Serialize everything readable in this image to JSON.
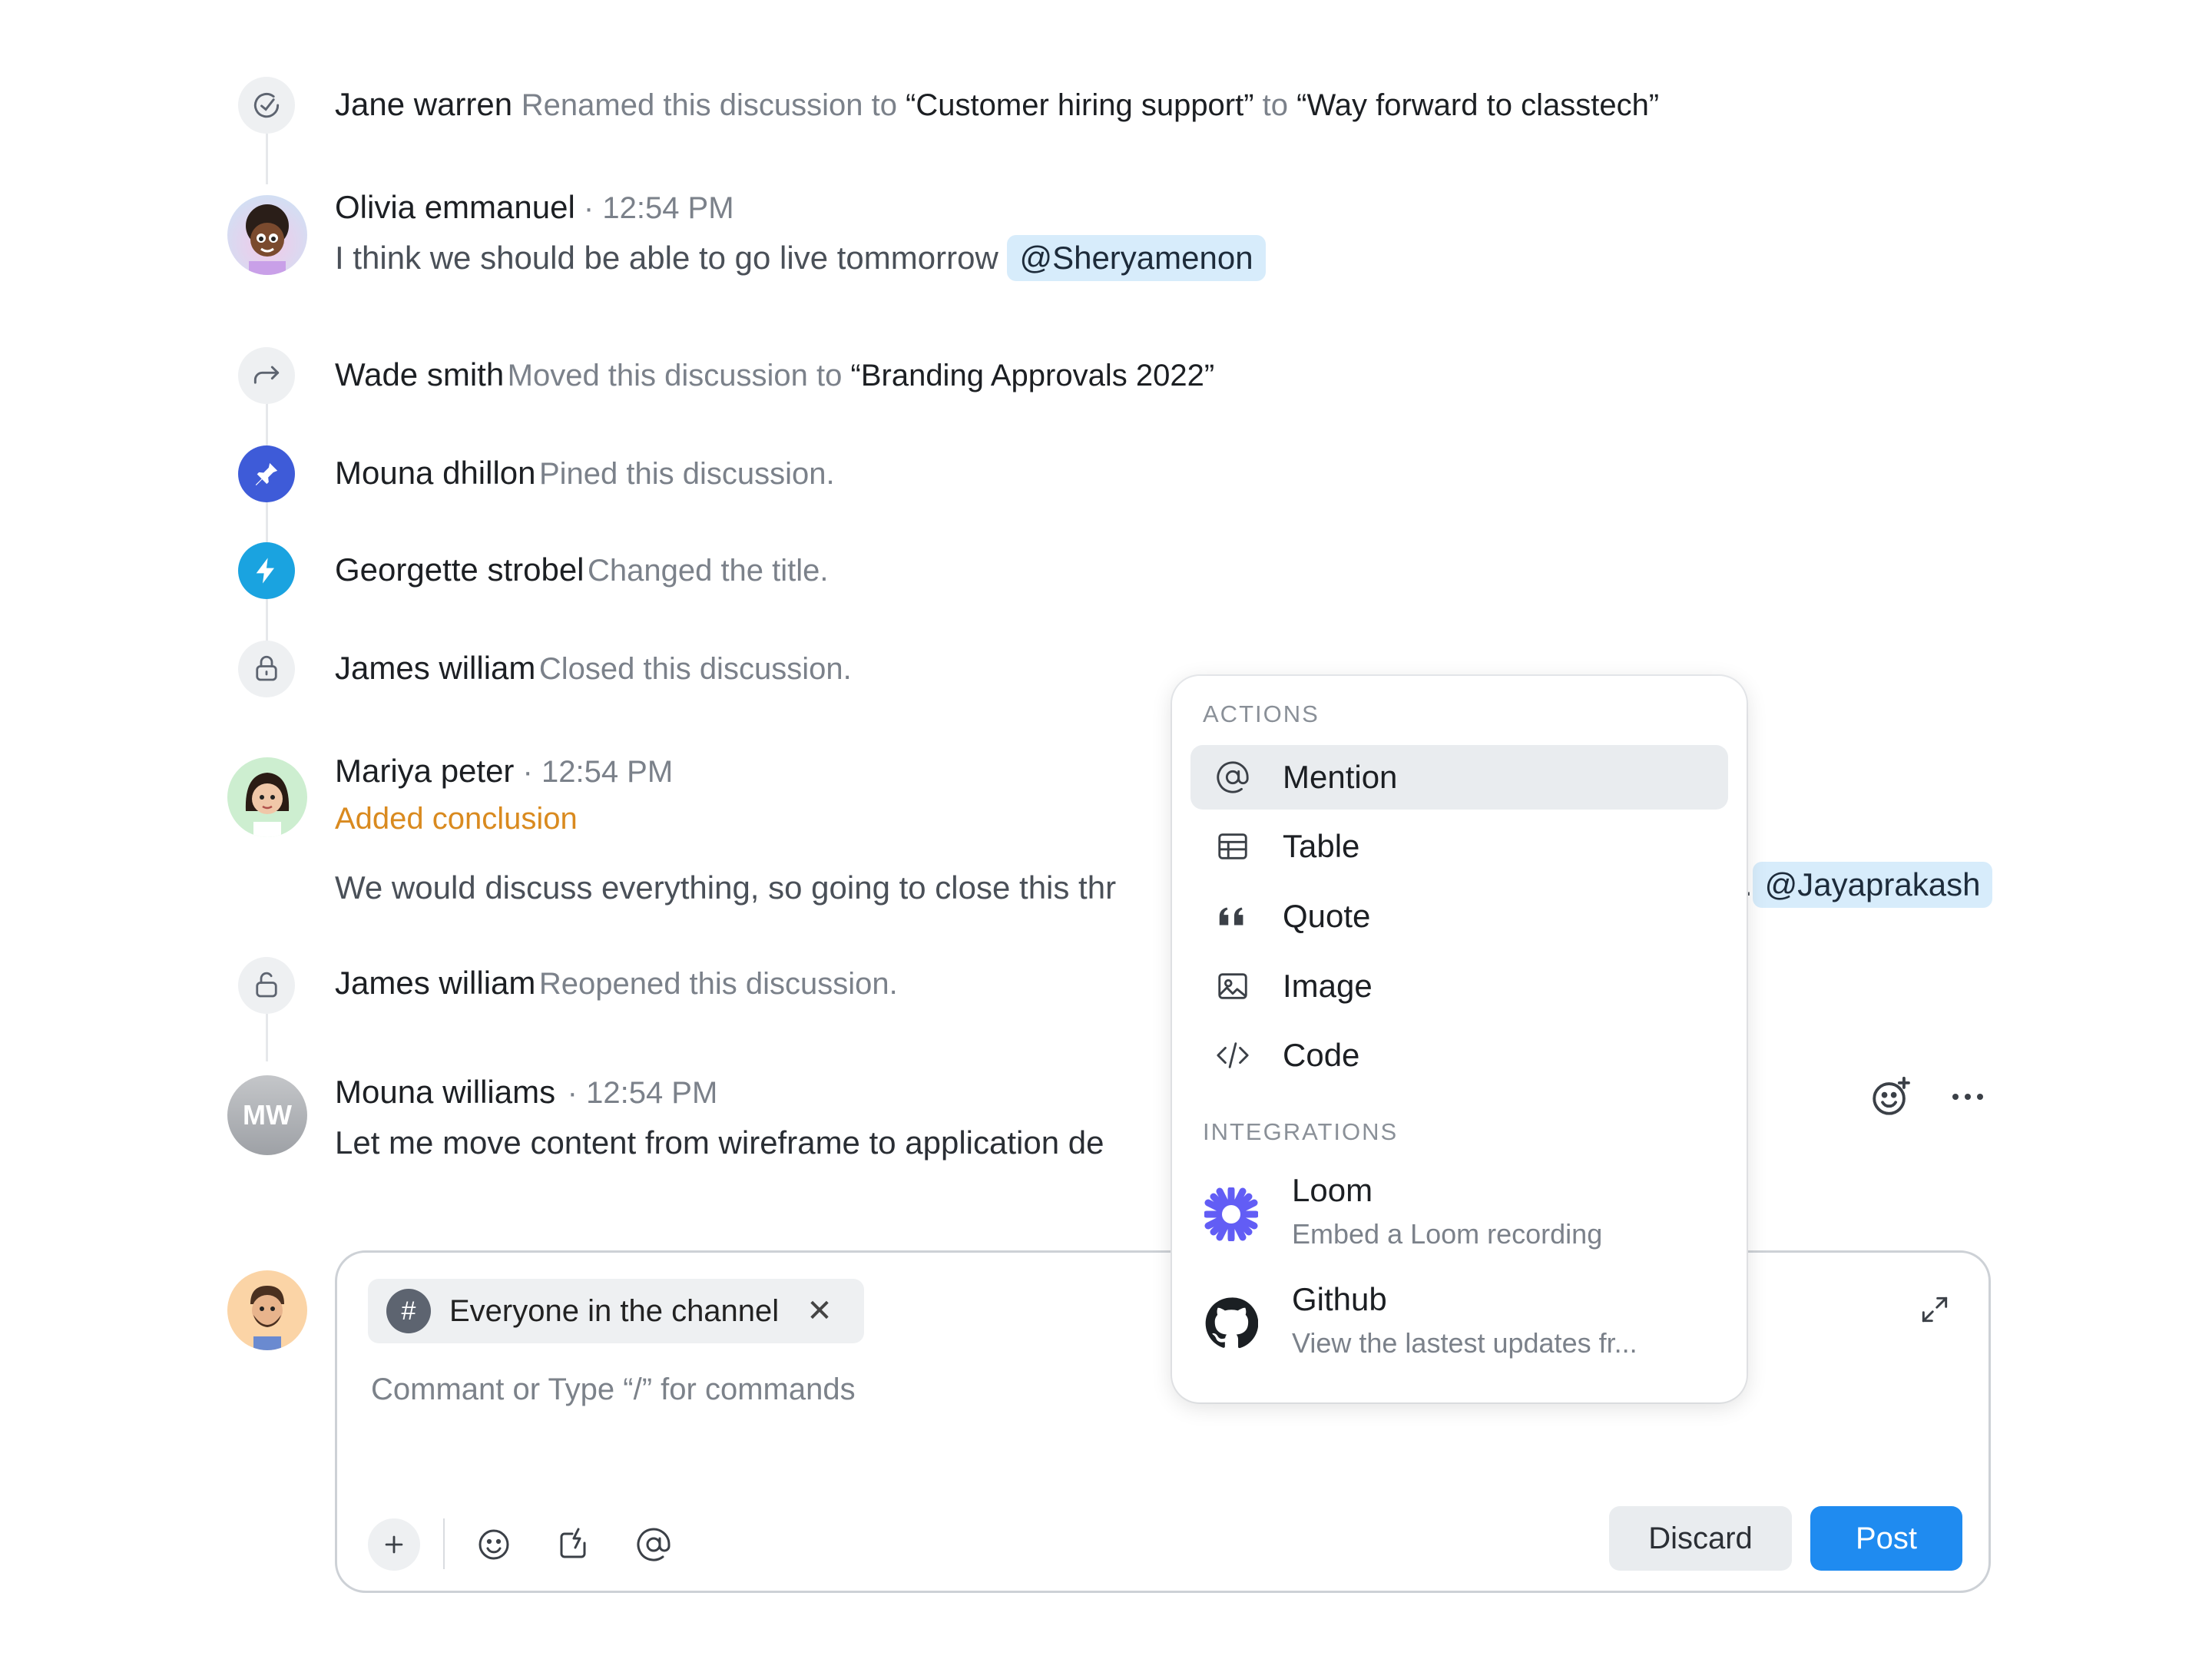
{
  "timeline": [
    {
      "type": "event",
      "icon": "check-icon",
      "name": "Jane warren",
      "prefix": "Renamed this discussion to ",
      "q1": "“Customer hiring support”",
      "mid": " to ",
      "q2": "“Way forward to classtech”"
    },
    {
      "type": "message",
      "name": "Olivia emmanuel",
      "time": " · 12:54 PM",
      "text": "I think we should be able to go live tommorrow ",
      "mention": "@Sheryamenon"
    },
    {
      "type": "event",
      "icon": "forward-arrow-icon",
      "name": "Wade smith",
      "action": "Moved this discussion to ",
      "target": "“Branding Approvals 2022”"
    },
    {
      "type": "event",
      "icon": "pin-icon",
      "name": "Mouna dhillon",
      "action": "Pined this discussion."
    },
    {
      "type": "event",
      "icon": "lightning-icon",
      "name": "Georgette strobel",
      "action": "Changed the title."
    },
    {
      "type": "event",
      "icon": "lock-icon",
      "name": "James william",
      "action": "Closed this discussion."
    },
    {
      "type": "message",
      "name": "Mariya peter",
      "time": " · 12:54 PM",
      "badge": "Added conclusion",
      "text": "We would discuss everything, so going to close this thr",
      "tail": ".",
      "mention": "@Jayaprakash"
    },
    {
      "type": "event",
      "icon": "unlock-icon",
      "name": "James william",
      "action": "Reopened this discussion."
    },
    {
      "type": "message",
      "name": "Mouna williams",
      "initials": "MW",
      "time": " · 12:54 PM",
      "text": "Let me move content from wireframe to application de"
    }
  ],
  "composer": {
    "chip_label": "Everyone in the channel",
    "chip_icon": "#",
    "placeholder": "Commant  or Type “/” for commands",
    "discard": "Discard",
    "post": "Post"
  },
  "menu": {
    "actions_header": "ACTIONS",
    "actions": [
      {
        "label": "Mention",
        "icon": "at-icon",
        "active": true
      },
      {
        "label": "Table",
        "icon": "table-icon"
      },
      {
        "label": "Quote",
        "icon": "quote-icon"
      },
      {
        "label": "Image",
        "icon": "image-icon"
      },
      {
        "label": "Code",
        "icon": "code-icon"
      }
    ],
    "integrations_header": "INTEGRATIONS",
    "integrations": [
      {
        "title": "Loom",
        "subtitle": "Embed a Loom recording",
        "icon": "loom-icon"
      },
      {
        "title": "Github",
        "subtitle": "View the lastest updates fr...",
        "icon": "github-icon"
      }
    ]
  },
  "colors": {
    "accent": "#1f8bf0",
    "mention_bg": "#d7ecfb",
    "conclusion": "#d98a1f",
    "pin": "#3e5bd8",
    "lightning": "#1aa3e0"
  }
}
